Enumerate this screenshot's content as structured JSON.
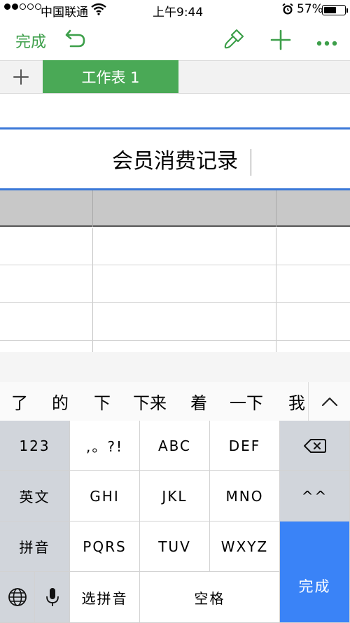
{
  "status": {
    "carrier": "中国联通",
    "time": "上午9:44",
    "battery": "57%"
  },
  "toolbar": {
    "done": "完成",
    "icons": [
      "undo-icon",
      "paintbrush-icon",
      "plus-icon",
      "more-icon"
    ]
  },
  "sheets": {
    "active_tab": "工作表 1"
  },
  "cell": {
    "title": "会员消费记录"
  },
  "candidates": [
    "了",
    "的",
    "下",
    "下来",
    "着",
    "一下",
    "我"
  ],
  "keyboard": {
    "row1": [
      "123",
      ",。?!",
      "ABC",
      "DEF"
    ],
    "row2": [
      "英文",
      "GHI",
      "JKL",
      "MNO",
      "^^"
    ],
    "row3": [
      "拼音",
      "PQRS",
      "TUV",
      "WXYZ"
    ],
    "row4": [
      "选拼音",
      "空格"
    ],
    "done": "完成"
  },
  "colors": {
    "accent": "#3d9f4a",
    "selection": "#3b78d8",
    "done_key": "#3a83f7"
  }
}
